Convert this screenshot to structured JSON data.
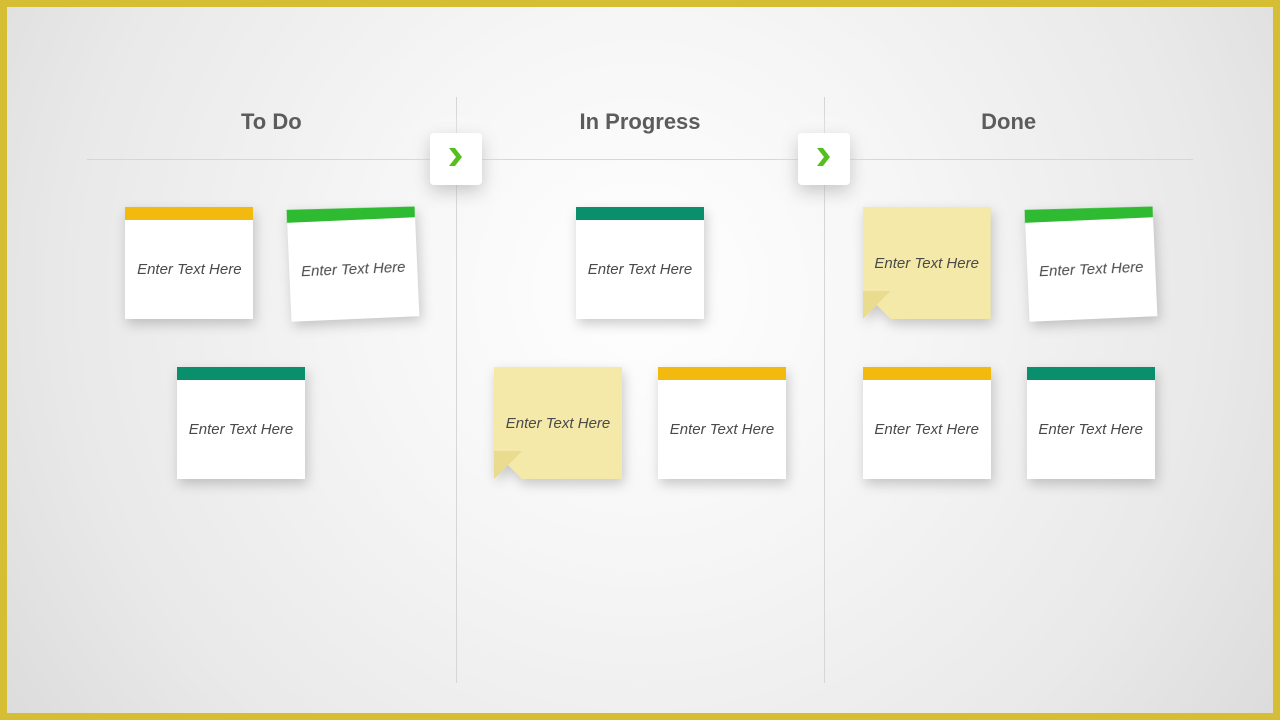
{
  "columns": {
    "todo": "To Do",
    "inprogress": "In Progress",
    "done": "Done"
  },
  "notes": {
    "todo": {
      "r1a": "Enter Text Here",
      "r1b": "Enter Text Here",
      "r2a": "Enter Text Here"
    },
    "inprogress": {
      "r1a": "Enter Text Here",
      "r2a": "Enter Text Here",
      "r2b": "Enter Text Here"
    },
    "done": {
      "r1a": "Enter Text Here",
      "r1b": "Enter Text Here",
      "r2a": "Enter Text Here",
      "r2b": "Enter Text Here"
    }
  },
  "colors": {
    "yellow": "#f2b90f",
    "green": "#2fbb31",
    "teal": "#0a8f6c",
    "noteYellow": "#f4e9a8",
    "frame": "#d5be33"
  }
}
